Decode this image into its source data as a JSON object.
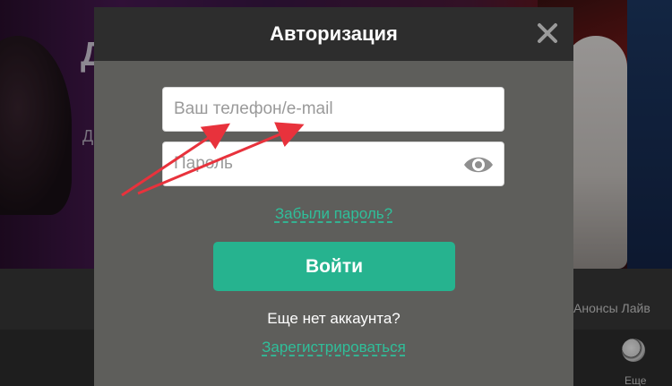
{
  "background": {
    "banner_letter": "Д",
    "banner_small_letter": "Д",
    "nav_text": "Анонсы Лайв",
    "bottom_text": "Еще"
  },
  "modal": {
    "title": "Авторизация",
    "login_field": {
      "value": "",
      "placeholder": "Ваш телефон/e-mail"
    },
    "password_field": {
      "value": "",
      "placeholder": "Пароль"
    },
    "forgot_password_label": "Забыли пароль?",
    "login_button_label": "Войти",
    "no_account_text": "Еще нет аккаунта?",
    "register_label": "Зарегистрироваться"
  },
  "icons": {
    "close": "close-icon",
    "eye": "eye-icon",
    "ball": "soccer-ball-icon"
  },
  "colors": {
    "accent": "#26b38f",
    "link": "#2fbf9a",
    "modal_bg": "#5e5e5b",
    "header_bg": "#2d2d2d",
    "annotation_arrow": "#e8323c"
  }
}
